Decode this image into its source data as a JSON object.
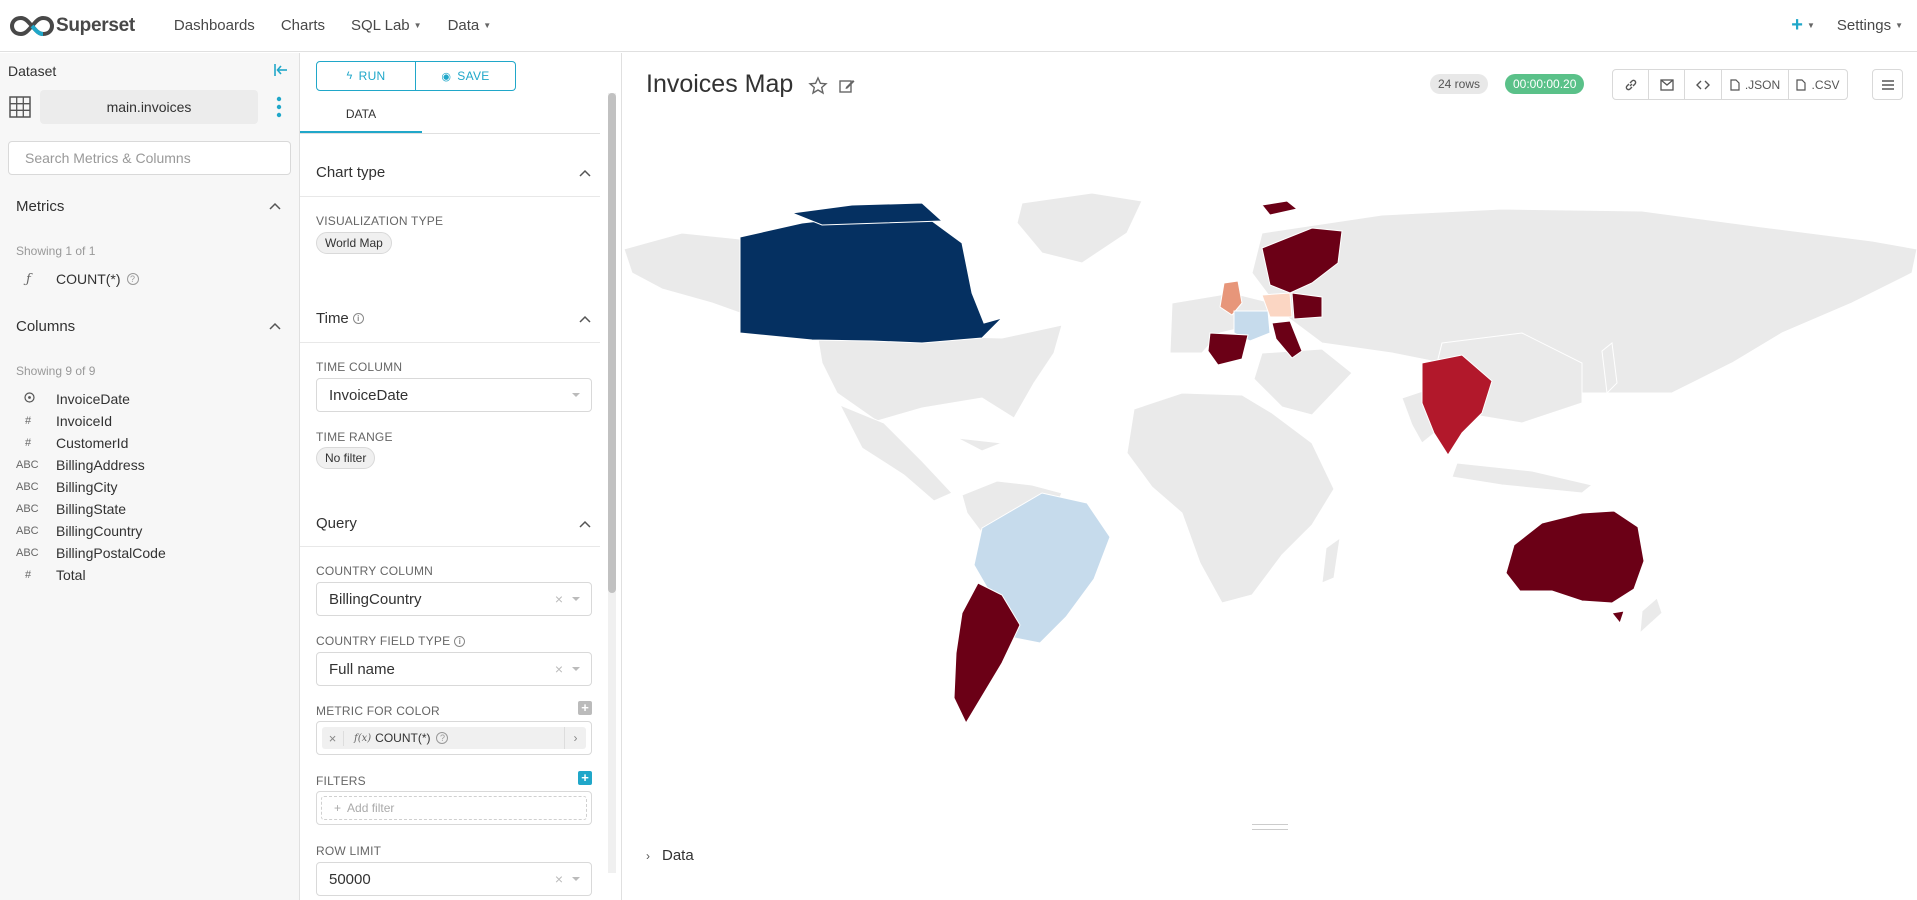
{
  "nav": {
    "brand": "Superset",
    "menu": [
      {
        "label": "Dashboards",
        "dropdown": false
      },
      {
        "label": "Charts",
        "dropdown": false
      },
      {
        "label": "SQL Lab",
        "dropdown": true
      },
      {
        "label": "Data",
        "dropdown": true
      }
    ],
    "new_icon": "plus-icon",
    "settings_label": "Settings"
  },
  "dataset": {
    "header": "Dataset",
    "name": "main.invoices",
    "search_placeholder": "Search Metrics & Columns",
    "metrics_title": "Metrics",
    "metrics_showing": "Showing 1 of 1",
    "metrics": [
      {
        "type": "ƒ",
        "name": "COUNT(*)"
      }
    ],
    "columns_title": "Columns",
    "columns_showing": "Showing 9 of 9",
    "columns": [
      {
        "type": "clock",
        "name": "InvoiceDate"
      },
      {
        "type": "#",
        "name": "InvoiceId"
      },
      {
        "type": "#",
        "name": "CustomerId"
      },
      {
        "type": "ABC",
        "name": "BillingAddress"
      },
      {
        "type": "ABC",
        "name": "BillingCity"
      },
      {
        "type": "ABC",
        "name": "BillingState"
      },
      {
        "type": "ABC",
        "name": "BillingCountry"
      },
      {
        "type": "ABC",
        "name": "BillingPostalCode"
      },
      {
        "type": "#",
        "name": "Total"
      }
    ]
  },
  "controls": {
    "run_label": "RUN",
    "save_label": "SAVE",
    "tab_data": "DATA",
    "chart_type_title": "Chart type",
    "viz_type_label": "VISUALIZATION TYPE",
    "viz_type_value": "World Map",
    "time_title": "Time",
    "time_column_label": "TIME COLUMN",
    "time_column_value": "InvoiceDate",
    "time_range_label": "TIME RANGE",
    "time_range_value": "No filter",
    "query_title": "Query",
    "country_column_label": "COUNTRY COLUMN",
    "country_column_value": "BillingCountry",
    "country_field_type_label": "COUNTRY FIELD TYPE",
    "country_field_type_value": "Full name",
    "metric_color_label": "METRIC FOR COLOR",
    "metric_color_value": "COUNT(*)",
    "filters_label": "FILTERS",
    "add_filter_placeholder": "Add filter",
    "row_limit_label": "ROW LIMIT",
    "row_limit_value": "50000"
  },
  "chart": {
    "title": "Invoices Map",
    "rows_badge": "24 rows",
    "time_badge": "00:00:00.20",
    "actions": [
      {
        "icon": "link-icon",
        "label": ""
      },
      {
        "icon": "mail-icon",
        "label": ""
      },
      {
        "icon": "code-icon",
        "label": ""
      },
      {
        "icon": "file-icon",
        "label": ".JSON"
      },
      {
        "icon": "file-icon",
        "label": ".CSV"
      }
    ],
    "data_section_label": "Data"
  },
  "colors": {
    "accent": "#20a7c9",
    "success": "#5ac189",
    "map_base": "#eaeaea",
    "map_dark_red": "#6b0016",
    "map_red": "#b2182b",
    "map_salmon": "#e7967a",
    "map_light_peach": "#fbd6c3",
    "map_light_blue": "#c6dbec",
    "map_navy": "#053061"
  }
}
